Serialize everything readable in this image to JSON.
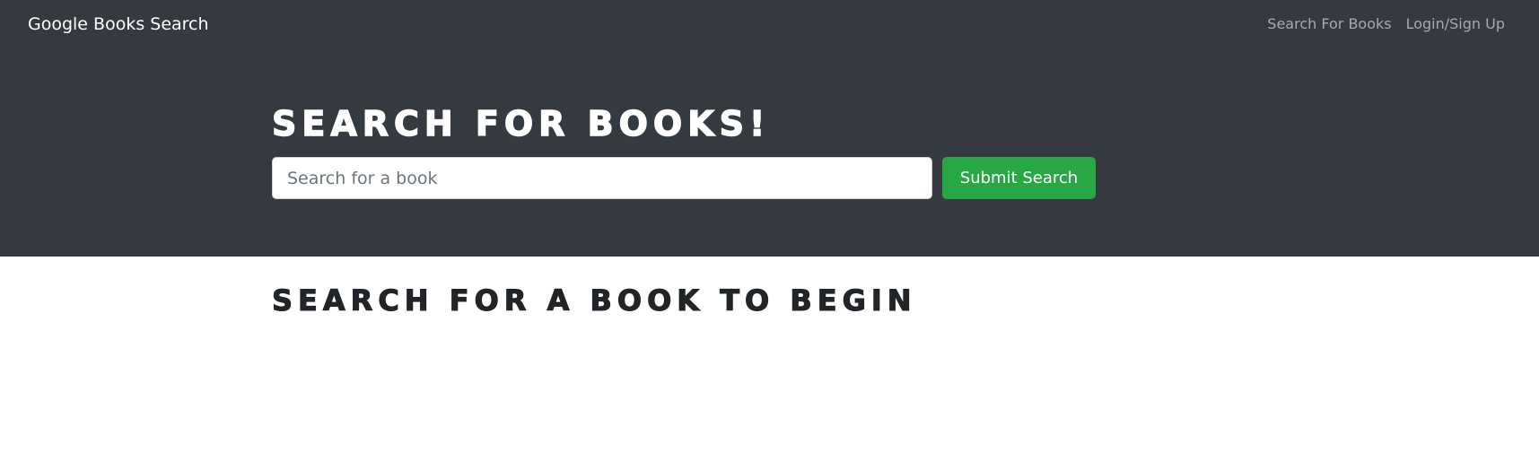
{
  "navbar": {
    "brand": "Google Books Search",
    "links": [
      {
        "label": "Search For Books"
      },
      {
        "label": "Login/Sign Up"
      }
    ]
  },
  "hero": {
    "title": "SEARCH FOR BOOKS!",
    "search": {
      "value": "",
      "placeholder": "Search for a book"
    },
    "submit_label": "Submit Search"
  },
  "results": {
    "heading": "SEARCH FOR A BOOK TO BEGIN"
  },
  "colors": {
    "navbar_bg": "#343a40",
    "submit_bg": "#28a745",
    "heading_dark": "#212529"
  }
}
